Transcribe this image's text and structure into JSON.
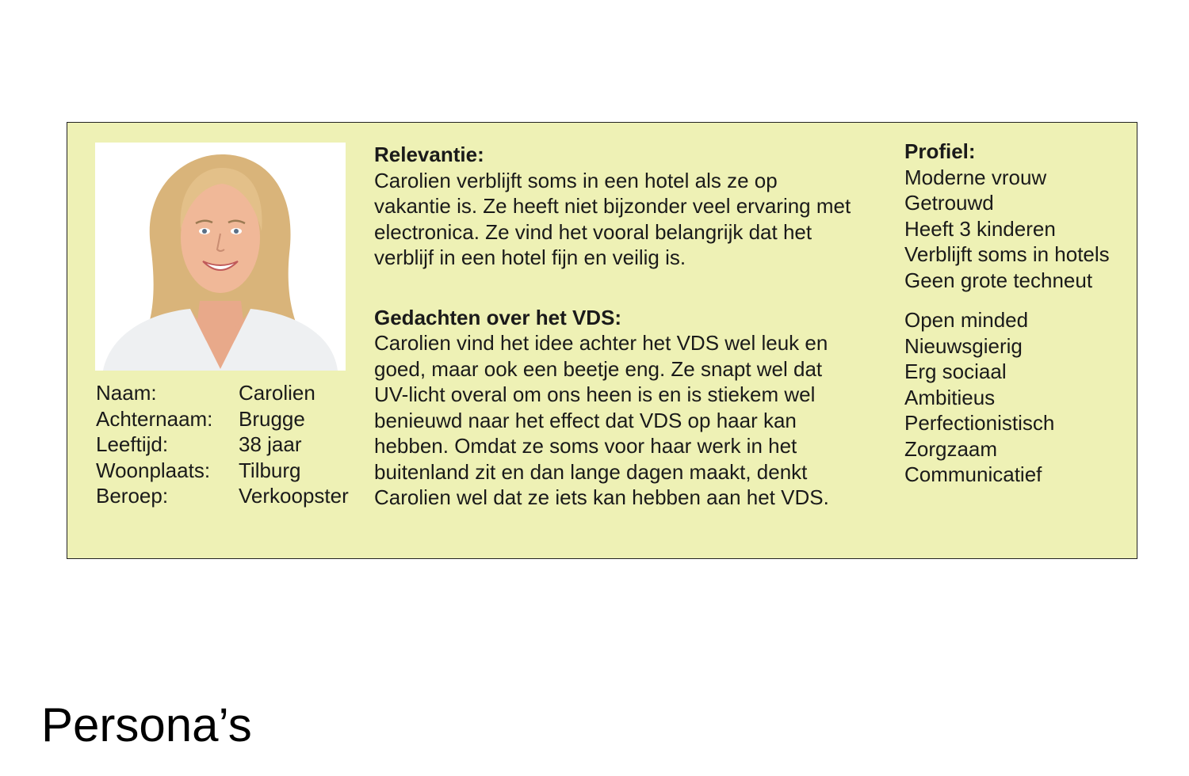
{
  "slide": {
    "title": "Persona’s"
  },
  "persona": {
    "photo_icon": "portrait-photo",
    "details": [
      {
        "label": "Naam:",
        "value": "Carolien"
      },
      {
        "label": "Achternaam:",
        "value": "Brugge"
      },
      {
        "label": "Leeftijd:",
        "value": "38 jaar"
      },
      {
        "label": "Woonplaats:",
        "value": "Tilburg"
      },
      {
        "label": "Beroep:",
        "value": "Verkoopster"
      }
    ],
    "relevance": {
      "heading": "Relevantie:",
      "text": "Carolien verblijft soms in een hotel als ze op vakantie is. Ze heeft niet bijzonder veel ervaring met electronica. Ze vind het vooral belangrijk dat het verblijf in een hotel fijn en veilig is."
    },
    "thoughts": {
      "heading": "Gedachten over het VDS:",
      "text": "Carolien vind het idee achter het VDS wel leuk en goed, maar ook een beetje eng. Ze snapt wel dat UV-licht overal om ons heen is en is stiekem wel benieuwd naar het effect dat VDS op haar kan hebben. Omdat ze soms voor haar werk in het buitenland zit en dan lange dagen maakt, denkt Carolien wel dat ze iets kan hebben aan het VDS."
    },
    "profile": {
      "heading": "Profiel:",
      "group1": [
        "Moderne vrouw",
        "Getrouwd",
        "Heeft 3 kinderen",
        "Verblijft soms in hotels",
        "Geen grote techneut"
      ],
      "group2": [
        "Open minded",
        "Nieuwsgierig",
        "Erg sociaal",
        "Ambitieus",
        "Perfectionistisch",
        "Zorgzaam",
        "Communicatief"
      ]
    }
  },
  "colors": {
    "card_background": "#eef1b5",
    "card_border": "#222222"
  }
}
